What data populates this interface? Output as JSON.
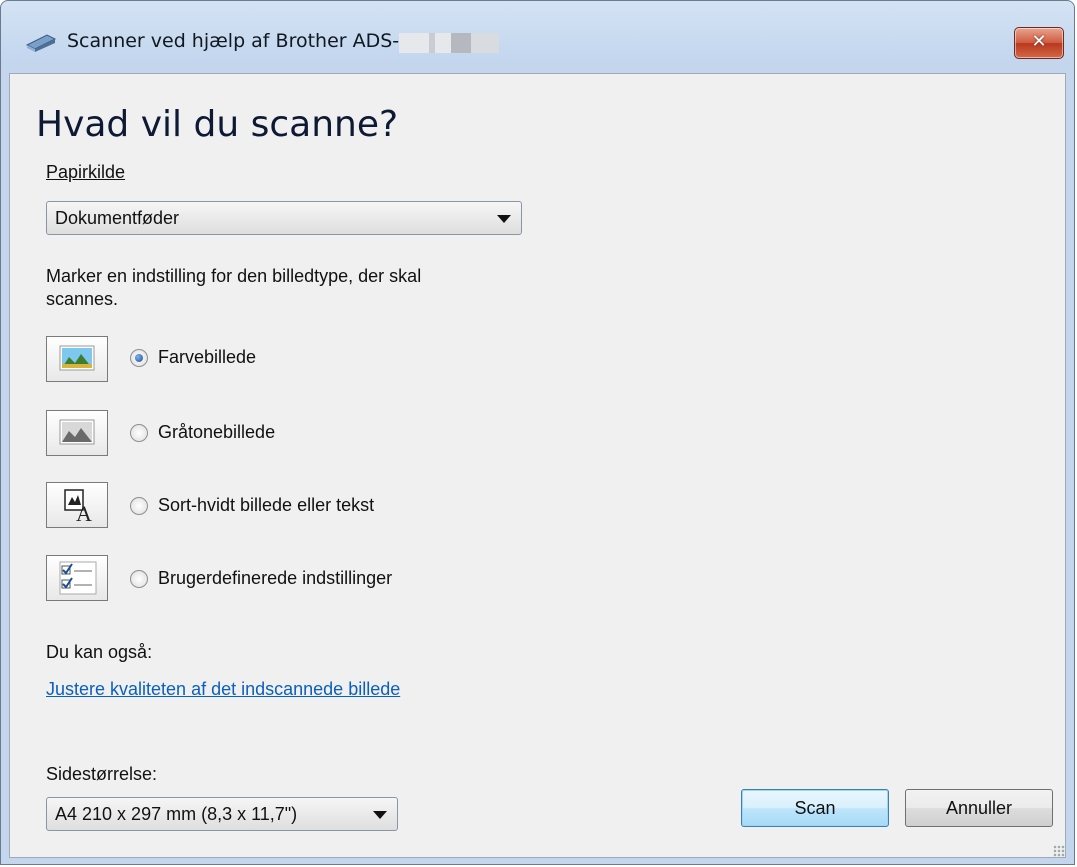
{
  "window": {
    "title": "Scanner ved hjælp af Brother ADS-",
    "close_label": "✕"
  },
  "heading": "Hvad vil du scanne?",
  "paper_source": {
    "label": "Papirkilde",
    "value": "Dokumentføder"
  },
  "instruction": [
    "Marker en indstilling for den billedtype, der skal",
    "scannes."
  ],
  "options": [
    {
      "label": "Farvebillede",
      "icon": "color-picture-icon",
      "selected": true
    },
    {
      "label": "Gråtonebillede",
      "icon": "grayscale-picture-icon",
      "selected": false
    },
    {
      "label": "Sort-hvidt billede eller tekst",
      "icon": "black-white-text-icon",
      "selected": false
    },
    {
      "label": "Brugerdefinerede indstillinger",
      "icon": "custom-settings-icon",
      "selected": false
    }
  ],
  "also": {
    "label": "Du kan også:",
    "link": "Justere kvaliteten af det indscannede billede"
  },
  "page_size": {
    "label": "Sidestørrelse:",
    "value": "A4 210 x 297 mm (8,3 x 11,7\")"
  },
  "buttons": {
    "scan": "Scan",
    "cancel": "Annuller"
  },
  "colors": {
    "link": "#0b5fbf",
    "close": "#c9472d",
    "selected_radio": "#1a4e9c"
  }
}
